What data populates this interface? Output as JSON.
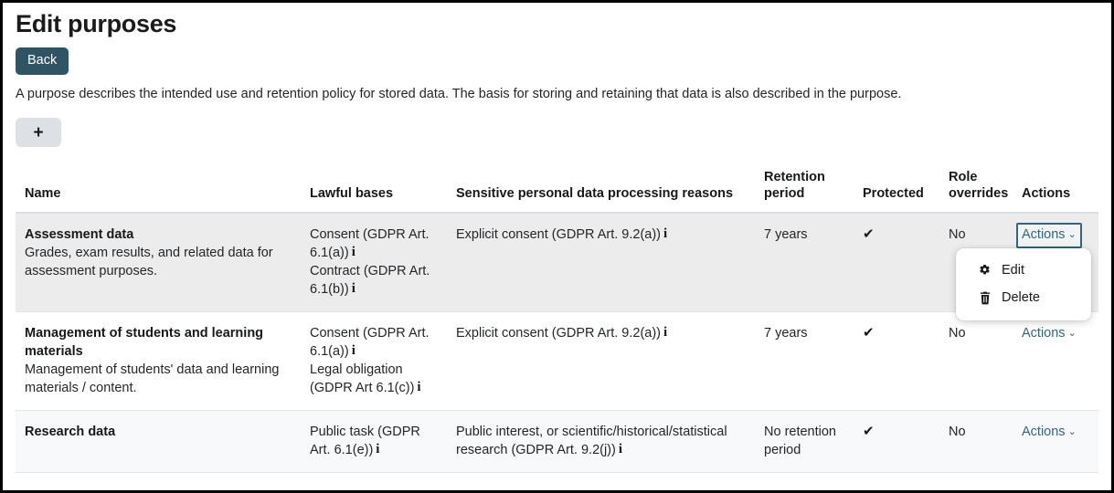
{
  "header": {
    "title": "Edit purposes",
    "back_label": "Back",
    "intro": "A purpose describes the intended use and retention policy for stored data. The basis for storing and retaining that data is also described in the purpose.",
    "add_label": "+",
    "add_icon": "plus-icon"
  },
  "colors": {
    "back_button_bg": "#2f5463",
    "add_button_bg": "#dde1e6",
    "link": "#34657a",
    "row_hover_bg": "#ececec",
    "row_stripe_bg": "#f8f9fa",
    "text": "#22262a"
  },
  "table": {
    "columns": [
      {
        "label": "Name"
      },
      {
        "label": "Lawful bases"
      },
      {
        "label": "Sensitive personal data processing reasons"
      },
      {
        "label": "Retention period"
      },
      {
        "label": "Protected"
      },
      {
        "label": "Role overrides"
      },
      {
        "label": "Actions"
      }
    ],
    "rows": [
      {
        "name": "Assessment data",
        "description": "Grades, exam results, and related data for assessment purposes.",
        "lawful_bases": [
          "Consent (GDPR Art. 6.1(a))",
          "Contract (GDPR Art. 6.1(b))"
        ],
        "sensitive_reasons": [
          "Explicit consent (GDPR Art. 9.2(a))"
        ],
        "retention_period": "7 years",
        "protected": "✔",
        "role_overrides": "No",
        "actions_label": "Actions"
      },
      {
        "name": "Management of students and learning materials",
        "description": "Management of students' data and learning materials / content.",
        "lawful_bases": [
          "Consent (GDPR Art. 6.1(a))",
          "Legal obligation (GDPR Art 6.1(c))"
        ],
        "sensitive_reasons": [
          "Explicit consent (GDPR Art. 9.2(a))"
        ],
        "retention_period": "7 years",
        "protected": "✔",
        "role_overrides": "No",
        "actions_label": "Actions"
      },
      {
        "name": "Research data",
        "description": "",
        "lawful_bases": [
          "Public task (GDPR Art. 6.1(e))"
        ],
        "sensitive_reasons": [
          "Public interest, or scientific/historical/statistical research (GDPR Art. 9.2(j))"
        ],
        "retention_period": "No retention period",
        "protected": "✔",
        "role_overrides": "No",
        "actions_label": "Actions"
      }
    ]
  },
  "dropdown": {
    "open_for_row": 0,
    "items": [
      {
        "label": "Edit",
        "icon": "gear-icon"
      },
      {
        "label": "Delete",
        "icon": "trash-icon"
      }
    ]
  },
  "icons": {
    "info": "i",
    "caret_down": "⌄"
  }
}
